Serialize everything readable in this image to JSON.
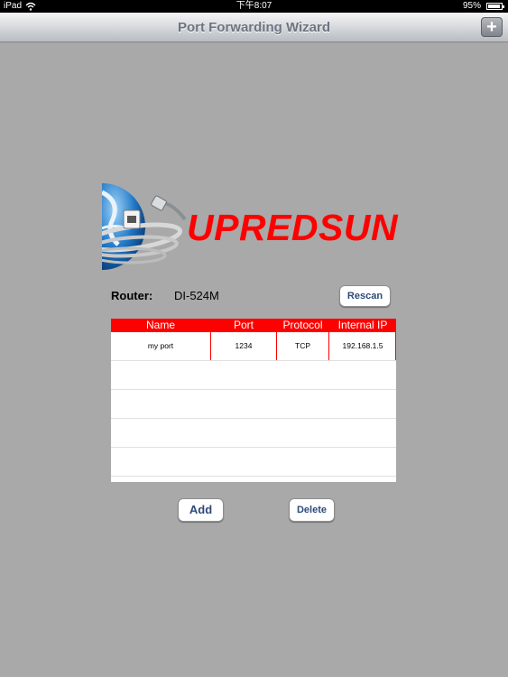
{
  "status_bar": {
    "carrier": "iPad",
    "time": "下午8:07",
    "battery": "95%",
    "battery_level": 0.95
  },
  "nav": {
    "title": "Port Forwarding Wizard",
    "add_label": "+"
  },
  "logo": {
    "brand": "UPREDSUN"
  },
  "router": {
    "label": "Router:",
    "value": "DI-524M",
    "rescan_label": "Rescan"
  },
  "table": {
    "headers": [
      "Name",
      "Port",
      "Protocol",
      "Internal IP"
    ],
    "rows": [
      [
        "my port",
        "1234",
        "TCP",
        "192.168.1.5"
      ]
    ]
  },
  "actions": {
    "add_label": "Add",
    "delete_label": "Delete"
  },
  "colors": {
    "background": "#a9a9a9",
    "accent_red": "#ff0000",
    "button_text": "#2d4a7a"
  }
}
